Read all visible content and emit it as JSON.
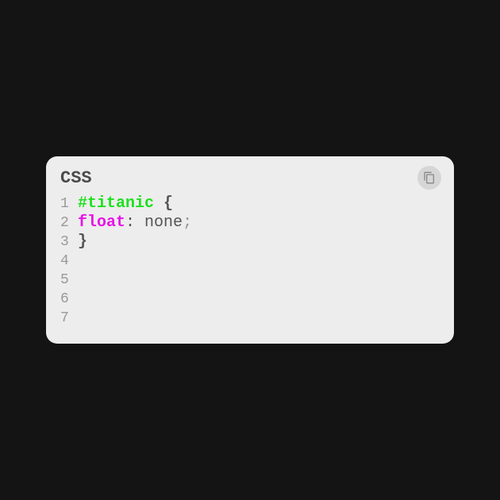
{
  "header": {
    "language": "CSS"
  },
  "code": {
    "lines": [
      {
        "num": "1",
        "tokens": [
          {
            "cls": "tok-selector",
            "text": "#titanic"
          },
          {
            "cls": "",
            "text": " "
          },
          {
            "cls": "tok-brace",
            "text": "{"
          }
        ]
      },
      {
        "num": "2",
        "tokens": [
          {
            "cls": "tok-property",
            "text": "float"
          },
          {
            "cls": "tok-colon",
            "text": ":"
          },
          {
            "cls": "",
            "text": " "
          },
          {
            "cls": "tok-value",
            "text": "none"
          },
          {
            "cls": "tok-semi",
            "text": ";"
          }
        ]
      },
      {
        "num": "3",
        "tokens": [
          {
            "cls": "tok-brace",
            "text": "}"
          }
        ]
      },
      {
        "num": "4",
        "tokens": []
      },
      {
        "num": "5",
        "tokens": []
      },
      {
        "num": "6",
        "tokens": []
      },
      {
        "num": "7",
        "tokens": []
      }
    ]
  }
}
